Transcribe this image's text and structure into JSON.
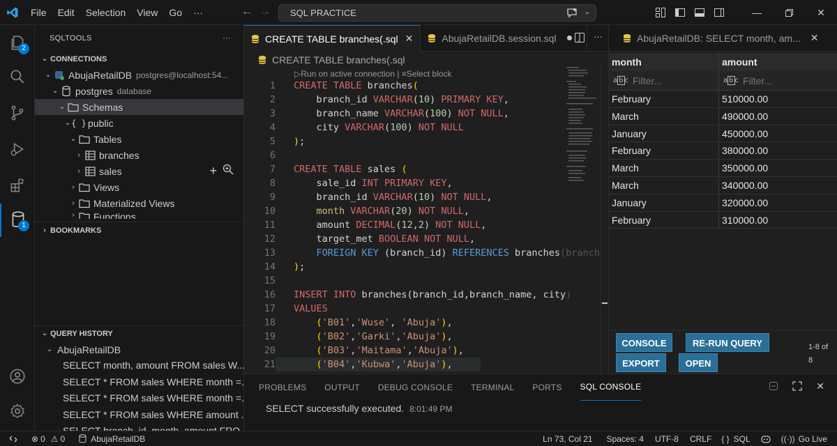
{
  "menu": [
    "File",
    "Edit",
    "Selection",
    "View",
    "Go",
    "···"
  ],
  "command_center": {
    "text": "SQL PRACTICE"
  },
  "sidebar": {
    "title": "SQLTOOLS",
    "connections_header": "CONNECTIONS",
    "connection": {
      "name": "AbujaRetailDB",
      "detail": "postgres@localhost:54..."
    },
    "database": {
      "name": "postgres",
      "kind": "database"
    },
    "schemas": "Schemas",
    "schema": "public",
    "tables": "Tables",
    "table_items": [
      "branches",
      "sales"
    ],
    "views": "Views",
    "materialized_views": "Materialized Views",
    "functions": "Functions",
    "bookmarks_header": "BOOKMARKS",
    "history_header": "QUERY HISTORY",
    "history_db": "AbujaRetailDB",
    "history_items": [
      "SELECT month, amount FROM sales W...",
      "SELECT * FROM sales WHERE month =...",
      "SELECT * FROM sales WHERE month =...",
      "SELECT * FROM sales WHERE amount ...",
      "SELECT branch_id, month, amount FRO..."
    ]
  },
  "activity": {
    "explorer_badge": "2",
    "db_badge": "1"
  },
  "editor": {
    "tab_active": "CREATE TABLE branches(.sql",
    "tab_inactive": "AbujaRetailDB.session.sql",
    "tab_inactive_suffix": ".",
    "breadcrumb": "CREATE TABLE branches(.sql",
    "codelens_run": "Run on active connection",
    "codelens_sep": "|",
    "codelens_select": "Select block",
    "line_numbers": [
      "1",
      "2",
      "3",
      "4",
      "5",
      "6",
      "7",
      "8",
      "9",
      "10",
      "11",
      "12",
      "13",
      "14",
      "15",
      "16",
      "17",
      "18",
      "19",
      "20",
      "21"
    ]
  },
  "results": {
    "tab": "AbujaRetailDB: SELECT month, am...",
    "columns": [
      "month",
      "amount"
    ],
    "filter_placeholder": "Filter...",
    "rows": [
      [
        "February",
        "510000.00"
      ],
      [
        "March",
        "490000.00"
      ],
      [
        "January",
        "450000.00"
      ],
      [
        "February",
        "380000.00"
      ],
      [
        "March",
        "350000.00"
      ],
      [
        "March",
        "340000.00"
      ],
      [
        "January",
        "320000.00"
      ],
      [
        "February",
        "310000.00"
      ]
    ],
    "buttons": {
      "console": "CONSOLE",
      "rerun": "RE-RUN QUERY",
      "export": "EXPORT",
      "open": "OPEN"
    },
    "count_line1": "1-8 of",
    "count_line2": "8"
  },
  "panel": {
    "tabs": [
      "PROBLEMS",
      "OUTPUT",
      "DEBUG CONSOLE",
      "TERMINAL",
      "PORTS",
      "SQL CONSOLE"
    ],
    "message": "SELECT successfully executed.",
    "time": "8:01:49 PM"
  },
  "status": {
    "errors": "0",
    "warnings": "0",
    "connection": "AbujaRetailDB",
    "position": "Ln 73, Col 21",
    "spaces": "Spaces: 4",
    "encoding": "UTF-8",
    "eol": "CRLF",
    "language": "SQL",
    "golive": "Go Live"
  },
  "colors": {
    "accent": "#0078d4",
    "button": "#2a6f97",
    "background": "#1f1f1f"
  }
}
